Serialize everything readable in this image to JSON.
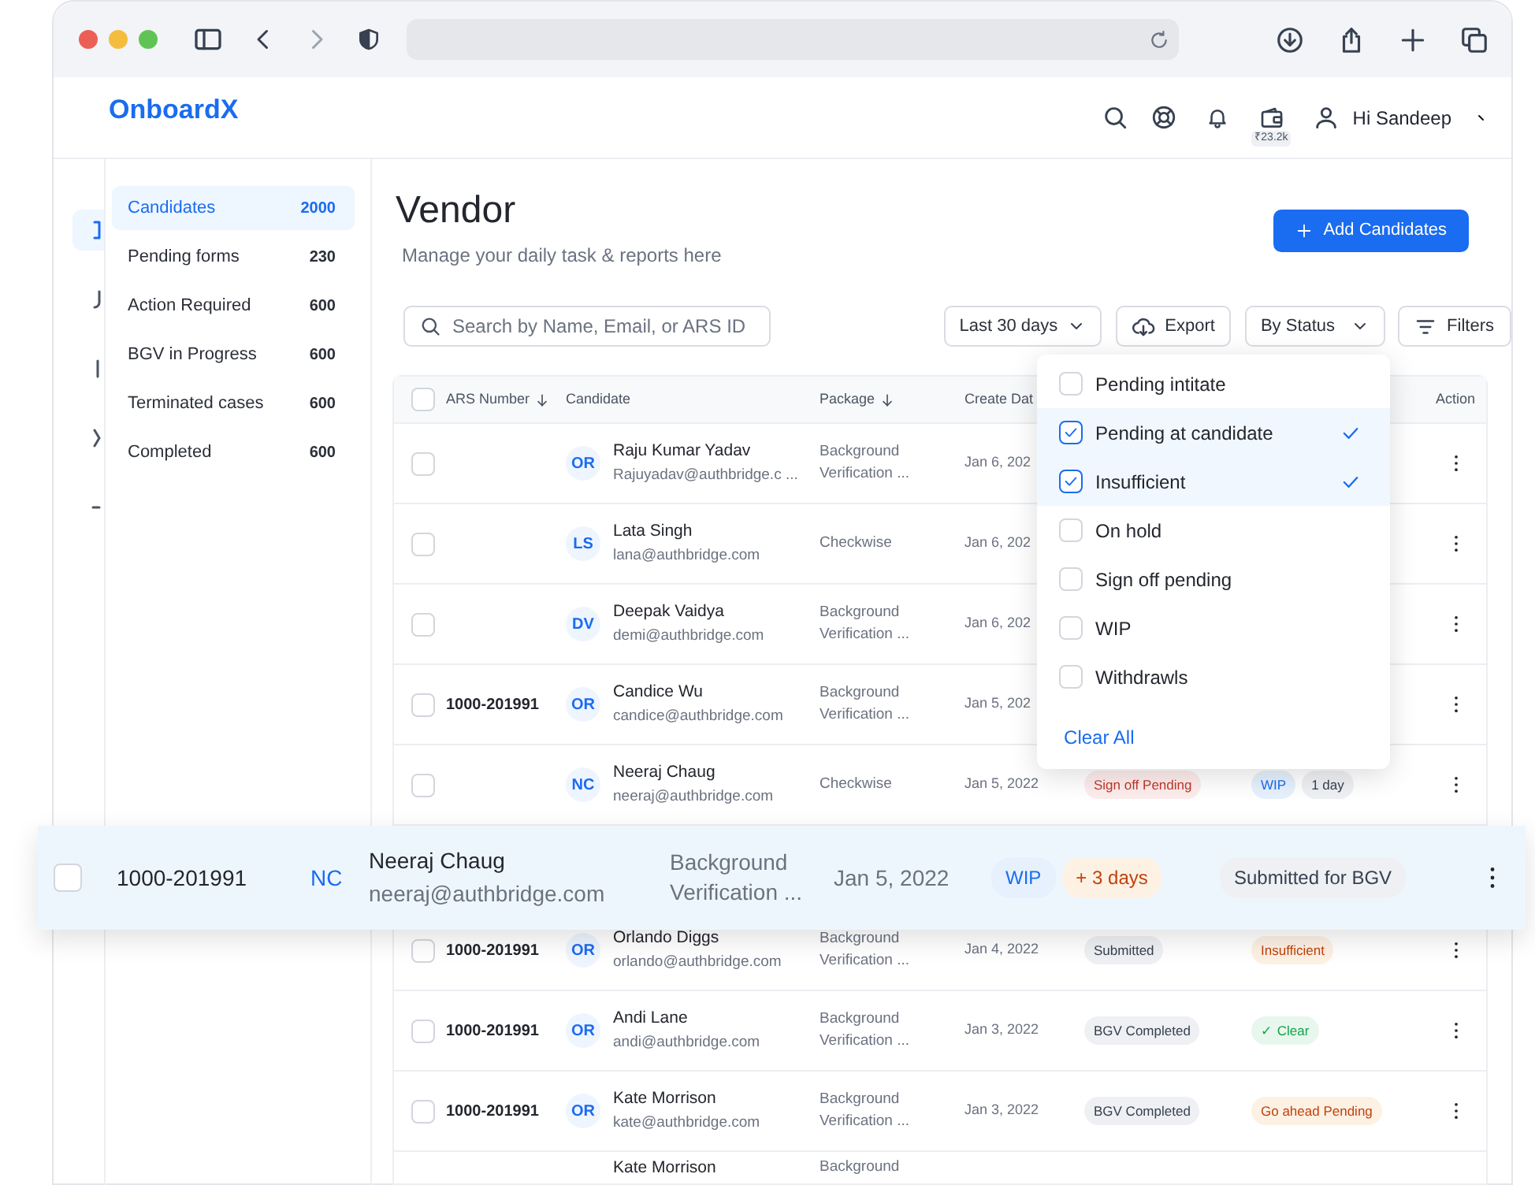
{
  "app": {
    "logo": "OnboardX",
    "wallet_badge": "₹23.2k",
    "greeting": "Hi Sandeep"
  },
  "rail": [
    {
      "selected": true
    },
    {
      "selected": false
    },
    {
      "selected": false
    },
    {
      "selected": false
    },
    {
      "selected": false
    }
  ],
  "sidebar": [
    {
      "label": "Candidates",
      "count": "2000",
      "selected": true
    },
    {
      "label": "Pending forms",
      "count": "230",
      "selected": false
    },
    {
      "label": "Action Required",
      "count": "600",
      "selected": false
    },
    {
      "label": "BGV in Progress",
      "count": "600",
      "selected": false
    },
    {
      "label": "Terminated cases",
      "count": "600",
      "selected": false
    },
    {
      "label": "Completed",
      "count": "600",
      "selected": false
    }
  ],
  "page": {
    "title": "Vendor",
    "subtitle": "Manage your daily task & reports here",
    "add_button": "Add Candidates"
  },
  "toolbar": {
    "search_placeholder": "Search by Name, Email, or ARS ID",
    "date_filter": "Last 30 days",
    "export": "Export",
    "status_filter": "By Status",
    "filters": "Filters"
  },
  "status_dropdown": {
    "options": [
      {
        "label": "Pending intitate",
        "checked": false
      },
      {
        "label": "Pending at candidate",
        "checked": true
      },
      {
        "label": "Insufficient",
        "checked": true
      },
      {
        "label": "On hold",
        "checked": false
      },
      {
        "label": "Sign off pending",
        "checked": false
      },
      {
        "label": "WIP",
        "checked": false
      },
      {
        "label": "Withdrawls",
        "checked": false
      }
    ],
    "clear": "Clear All"
  },
  "table": {
    "columns": [
      {
        "label": "ARS Number",
        "sortable": true
      },
      {
        "label": "Candidate",
        "sortable": false
      },
      {
        "label": "Package",
        "sortable": true
      },
      {
        "label": "Create Dat"
      },
      {
        "label": "Action",
        "sortable": false
      }
    ],
    "header_checked": false,
    "rows": [
      {
        "kind": "row",
        "checked": false,
        "initials": "OR",
        "name": "Raju Kumar Yadav",
        "email": "Rajuyadav@authbridge.c ...",
        "package": "Background Verification ...",
        "date": "Jan 6, 202"
      },
      {
        "kind": "row",
        "checked": false,
        "initials": "LS",
        "name": "Lata Singh",
        "email": "lana@authbridge.com",
        "package": "Checkwise",
        "date": "Jan 6, 202"
      },
      {
        "kind": "row",
        "checked": false,
        "initials": "DV",
        "name": "Deepak Vaidya",
        "email": "demi@authbridge.com",
        "package": "Background Verification ...",
        "date": "Jan 6, 202"
      },
      {
        "kind": "row",
        "checked": false,
        "ars": "1000-201991",
        "initials": "OR",
        "name": "Candice Wu",
        "email": "candice@authbridge.com",
        "package": "Background Verification ...",
        "date": "Jan 5, 202"
      },
      {
        "kind": "row",
        "checked": false,
        "initials": "NC",
        "name": "Neeraj Chaug",
        "email": "neeraj@authbridge.com",
        "package": "Checkwise",
        "date": "Jan 5, 2022",
        "column_6": [
          {
            "label": "Sign off Pending",
            "kind": "danger"
          }
        ],
        "column_7": [
          {
            "label": "WIP",
            "kind": "info"
          },
          {
            "label": "1 day",
            "kind": "neutral"
          }
        ]
      },
      {
        "kind": "floating",
        "floating": {
          "checked": false,
          "ars": "1000-201991",
          "initials": "NC",
          "name": "Neeraj Chaug",
          "email": "neeraj@authbridge.com",
          "package": "Background Verification ...",
          "date": "Jan 5, 2022",
          "stage": [
            {
              "label": "WIP",
              "kind": "info"
            },
            {
              "label": "+ 3 days",
              "kind": "warning"
            }
          ],
          "state": [
            {
              "label": "Submitted for BGV",
              "kind": "neutral"
            }
          ]
        }
      },
      {
        "kind": "row",
        "checked": false,
        "ars": "1000-201991",
        "initials": "OR",
        "name": "Orlando Diggs",
        "email": "orlando@authbridge.com",
        "package": "Background Verification ...",
        "date": "Jan 4, 2022",
        "column_6": [
          {
            "label": "Submitted",
            "kind": "neutral"
          }
        ],
        "column_7": [
          {
            "label": "Insufficient",
            "kind": "warning"
          }
        ]
      },
      {
        "kind": "row",
        "checked": false,
        "ars": "1000-201991",
        "initials": "OR",
        "name": "Andi Lane",
        "email": "andi@authbridge.com",
        "package": "Background Verification ...",
        "date": "Jan 3, 2022",
        "column_6": [
          {
            "label": "BGV Completed",
            "kind": "neutral"
          }
        ],
        "column_7": [
          {
            "label": "✓ Clear",
            "kind": "success"
          }
        ]
      },
      {
        "kind": "row",
        "checked": false,
        "ars": "1000-201991",
        "initials": "OR",
        "name": "Kate Morrison",
        "email": "kate@authbridge.com",
        "package": "Background Verification ...",
        "date": "Jan 3, 2022",
        "column_6": [
          {
            "label": "BGV Completed",
            "kind": "neutral"
          }
        ],
        "column_7": [
          {
            "label": "Go ahead Pending",
            "kind": "warning"
          }
        ]
      },
      {
        "kind": "partial",
        "name": "Kate Morrison",
        "package": "Background"
      }
    ]
  }
}
